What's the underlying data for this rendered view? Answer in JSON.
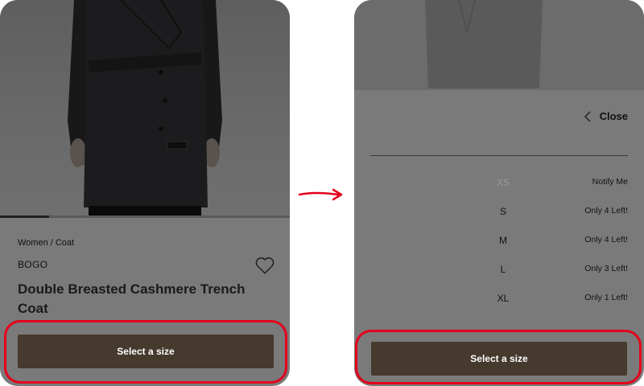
{
  "product": {
    "breadcrumb": "Women / Coat",
    "promo": "BOGO",
    "title": "Double Breasted Cashmere Trench Coat",
    "cta_label": "Select a size",
    "image_progress": 0.17
  },
  "size_panel": {
    "close_label": "Close",
    "cta_label": "Select a size",
    "sizes": [
      {
        "name": "XS",
        "status": "Notify Me",
        "available": false
      },
      {
        "name": "S",
        "status": "Only 4 Left!",
        "available": true
      },
      {
        "name": "M",
        "status": "Only 4 Left!",
        "available": true
      },
      {
        "name": "L",
        "status": "Only 3 Left!",
        "available": true
      },
      {
        "name": "XL",
        "status": "Only 1 Left!",
        "available": true
      }
    ]
  },
  "colors": {
    "cta": "#46392d",
    "highlight": "#e3001b",
    "overlay": "#7a7a7a"
  }
}
